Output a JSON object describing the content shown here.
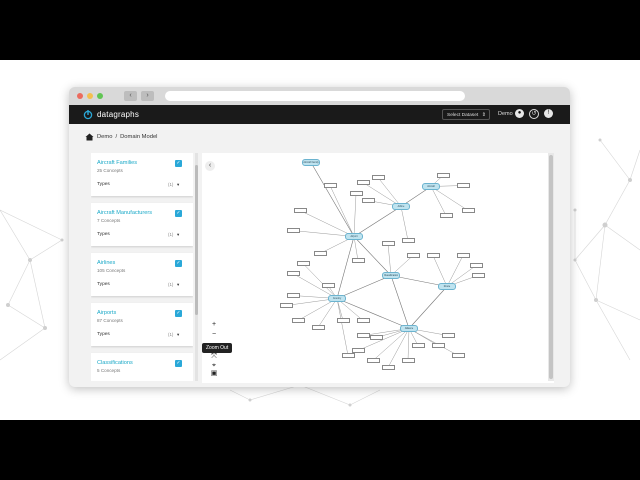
{
  "app": {
    "logo_text": "datagraphs",
    "dataset_select": "Select Dataset",
    "user_name": "Demo",
    "icons": [
      "user-icon",
      "history-icon",
      "chat-icon"
    ]
  },
  "breadcrumb": {
    "home": "Demo",
    "current": "Domain Model"
  },
  "sidebar": {
    "types_label": "Types",
    "cards": [
      {
        "title": "Aircraft Families",
        "count": "25 Concepts",
        "types_count": "(1)"
      },
      {
        "title": "Aircraft Manufacturers",
        "count": "7 Concepts",
        "types_count": "(1)"
      },
      {
        "title": "Airlines",
        "count": "105 Concepts",
        "types_count": "(1)"
      },
      {
        "title": "Airports",
        "count": "87 Concepts",
        "types_count": "(1)"
      },
      {
        "title": "Classifications",
        "count": "5 Concepts",
        "types_count": "(1)"
      }
    ]
  },
  "graph": {
    "tooltip": "Zoom Out",
    "controls": [
      "zoom-in-icon",
      "zoom-out-icon",
      "reset-icon",
      "layout-icon",
      "save-icon"
    ],
    "class_nodes": [
      "Aircraft Family",
      "Aircraft Manufacturer",
      "Airline",
      "Airport",
      "Classification",
      "Country",
      "Route",
      "Alliance",
      "Region"
    ]
  }
}
